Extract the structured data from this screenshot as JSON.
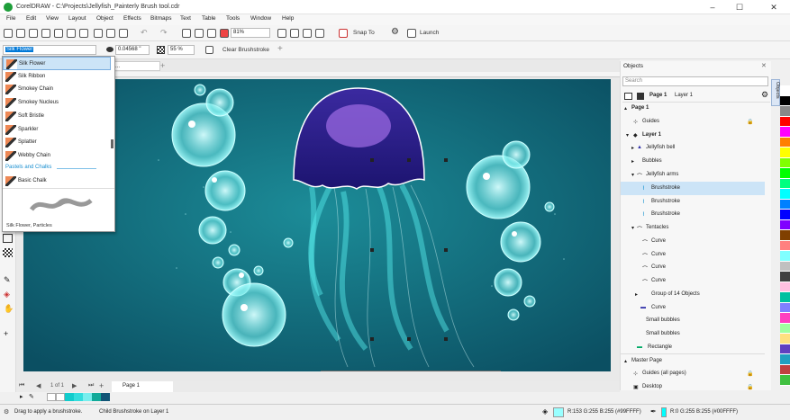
{
  "window": {
    "title": "CorelDRAW - C:\\Projects\\Jellyfish_Painterly Brush tool.cdr",
    "minimize": "–",
    "maximize": "☐",
    "close": "✕"
  },
  "menu": [
    "File",
    "Edit",
    "View",
    "Layout",
    "Object",
    "Effects",
    "Bitmaps",
    "Text",
    "Table",
    "Tools",
    "Window",
    "Help"
  ],
  "toolbar": {
    "zoom_value": "81%",
    "snap_label": "Snap To",
    "launch_label": "Launch"
  },
  "propbar": {
    "brush_value": "Silk Flower",
    "size_value": "0.04568 \"",
    "opacity_value": "55 %",
    "clear_label": "Clear Brushstroke",
    "add_label": "+"
  },
  "document_tab": "rly Brush t...",
  "brush_list": {
    "items": [
      "Silk Flower",
      "Silk Ribbon",
      "Smokey Chain",
      "Smokey Nucleus",
      "Soft Bristle",
      "Sparkler",
      "Splatter",
      "Webby Chain"
    ],
    "category": "Pastels and Chalks",
    "category_item": "Basic Chalk",
    "preview_caption": "Silk Flower, Particles"
  },
  "objects_panel": {
    "title": "Objects",
    "search_placeholder": "Search",
    "page_title": "Page 1",
    "layer_label": "Layer 1",
    "rows": [
      {
        "label": "Page 1"
      },
      {
        "label": "Guides"
      },
      {
        "label": "Layer 1"
      },
      {
        "label": "Jellyfish bell"
      },
      {
        "label": "Bubbles"
      },
      {
        "label": "Jellyfish arms"
      },
      {
        "label": "Brushstroke"
      },
      {
        "label": "Brushstroke"
      },
      {
        "label": "Brushstroke"
      },
      {
        "label": "Tentacles"
      },
      {
        "label": "Curve"
      },
      {
        "label": "Curve"
      },
      {
        "label": "Curve"
      },
      {
        "label": "Curve"
      },
      {
        "label": "Group of 14 Objects"
      },
      {
        "label": "Curve"
      },
      {
        "label": "Small bubbles"
      },
      {
        "label": "Small bubbles"
      },
      {
        "label": "Rectangle"
      },
      {
        "label": "Master Page"
      },
      {
        "label": "Guides (all pages)"
      },
      {
        "label": "Desktop"
      }
    ],
    "side_tab": "Objects"
  },
  "pages": {
    "counter": "1 of 1",
    "tab": "Page 1"
  },
  "status": {
    "hint": "Drag to apply a brushstroke.",
    "object_info": "Child Brushstroke on Layer 1",
    "fill_info": "R:153 G:255 B:255 (#99FFFF)",
    "outline_info": "R:0 G:255 B:255 (#00FFFF)"
  },
  "colors": {
    "accent": "#0078d7",
    "canvas_bg": "#0d5e6e",
    "bell": "#3a2a9c",
    "selection": "#cce4f7"
  },
  "palette": [
    "#ffffff",
    "#000000",
    "#888888",
    "#ff0000",
    "#ff00ff",
    "#ff8000",
    "#ffff00",
    "#80ff00",
    "#00ff00",
    "#00ff80",
    "#00ffff",
    "#0080ff",
    "#0000ff",
    "#8000ff",
    "#804000",
    "#ff8080",
    "#80ffff",
    "#c0c0c0",
    "#404040",
    "#ffc0e0",
    "#00c0a0",
    "#8080ff",
    "#ff40c0",
    "#a0ffa0",
    "#ffe080",
    "#6040c0",
    "#20a0c0",
    "#c04040",
    "#40c040"
  ]
}
